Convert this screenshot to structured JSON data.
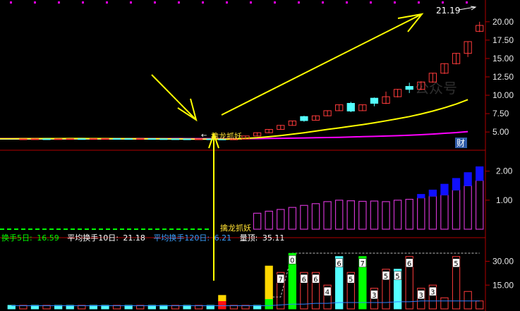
{
  "price_axis": {
    "ticks": [
      20.0,
      17.5,
      15.0,
      12.5,
      10.0,
      7.5,
      5.0
    ],
    "min": 3.0,
    "max": 22.0
  },
  "turnover_axis": {
    "ticks": [
      2.0,
      1.0
    ],
    "min": 0.0,
    "max": 2.6
  },
  "volume_axis": {
    "ticks": [
      30.0,
      15.0
    ],
    "min": 0.0,
    "max": 40.0
  },
  "price_high_label": "21.19",
  "badge_cai": "财",
  "watermark": "公众号",
  "signal_label_top": "擒龙抓妖",
  "signal_label_mid": "擒龙抓妖",
  "stats_bar": {
    "turnover5_label": "换手5日:",
    "turnover5_value": "16.59",
    "turnover10_label": "平均换手10日:",
    "turnover10_value": "21.18",
    "turnover120_label": "平均换手120日:",
    "turnover120_value": "6.21",
    "liangdu_label": "量顶:",
    "liangdu_value": "35.11"
  },
  "colors": {
    "up": "#ff3b3b",
    "down": "#54ffff",
    "ma_yellow": "#ffff00",
    "ma_magenta": "#ff00ff",
    "hist_purple": "#cc33cc",
    "hist_blue": "#1010ff",
    "vol_green": "#00ff00",
    "vol_yellow": "#ffd700",
    "stats_green": "#00ff00",
    "stats_blue": "#3aa0ff",
    "stats_white": "#ffffff"
  },
  "chart_data": {
    "type": "candlestick",
    "price_candles": [
      {
        "o": 4.02,
        "c": 4.05,
        "h": 4.1,
        "l": 4.0
      },
      {
        "o": 4.05,
        "c": 4.06,
        "h": 4.12,
        "l": 4.02
      },
      {
        "o": 4.06,
        "c": 4.05,
        "h": 4.1,
        "l": 4.0
      },
      {
        "o": 4.05,
        "c": 4.07,
        "h": 4.12,
        "l": 4.03
      },
      {
        "o": 4.07,
        "c": 4.08,
        "h": 4.12,
        "l": 4.05
      },
      {
        "o": 4.08,
        "c": 4.07,
        "h": 4.12,
        "l": 4.04
      },
      {
        "o": 4.07,
        "c": 4.09,
        "h": 4.14,
        "l": 4.05
      },
      {
        "o": 4.09,
        "c": 4.1,
        "h": 4.15,
        "l": 4.06
      },
      {
        "o": 4.1,
        "c": 4.09,
        "h": 4.14,
        "l": 4.05
      },
      {
        "o": 4.09,
        "c": 4.08,
        "h": 4.12,
        "l": 4.04
      },
      {
        "o": 4.08,
        "c": 4.09,
        "h": 4.13,
        "l": 4.05
      },
      {
        "o": 4.09,
        "c": 4.07,
        "h": 4.12,
        "l": 4.04
      },
      {
        "o": 4.07,
        "c": 4.06,
        "h": 4.1,
        "l": 4.02
      },
      {
        "o": 4.06,
        "c": 4.05,
        "h": 4.1,
        "l": 4.01
      },
      {
        "o": 4.05,
        "c": 4.04,
        "h": 4.08,
        "l": 4.0
      },
      {
        "o": 4.04,
        "c": 4.05,
        "h": 4.08,
        "l": 4.0
      },
      {
        "o": 4.05,
        "c": 4.03,
        "h": 4.08,
        "l": 3.98
      },
      {
        "o": 4.03,
        "c": 4.02,
        "h": 4.06,
        "l": 3.96
      },
      {
        "o": 4.02,
        "c": 4.04,
        "h": 4.08,
        "l": 3.98
      },
      {
        "o": 4.04,
        "c": 4.46,
        "h": 4.5,
        "l": 4.0
      },
      {
        "o": 4.46,
        "c": 4.9,
        "h": 4.95,
        "l": 4.4
      },
      {
        "o": 4.9,
        "c": 5.35,
        "h": 5.4,
        "l": 4.85
      },
      {
        "o": 5.35,
        "c": 5.9,
        "h": 5.95,
        "l": 5.3
      },
      {
        "o": 5.9,
        "c": 6.5,
        "h": 6.55,
        "l": 5.85
      },
      {
        "o": 7.1,
        "c": 6.55,
        "h": 7.2,
        "l": 6.4
      },
      {
        "o": 6.6,
        "c": 7.2,
        "h": 7.25,
        "l": 6.55
      },
      {
        "o": 7.2,
        "c": 7.9,
        "h": 7.95,
        "l": 7.15
      },
      {
        "o": 7.9,
        "c": 8.7,
        "h": 8.75,
        "l": 7.85
      },
      {
        "o": 8.9,
        "c": 7.85,
        "h": 9.1,
        "l": 7.7
      },
      {
        "o": 7.9,
        "c": 8.7,
        "h": 8.75,
        "l": 7.85
      },
      {
        "o": 9.6,
        "c": 8.9,
        "h": 9.7,
        "l": 8.5
      },
      {
        "o": 8.9,
        "c": 9.8,
        "h": 10.5,
        "l": 8.8
      },
      {
        "o": 9.8,
        "c": 10.8,
        "h": 10.85,
        "l": 9.7
      },
      {
        "o": 11.2,
        "c": 10.8,
        "h": 11.7,
        "l": 10.3
      },
      {
        "o": 10.8,
        "c": 11.8,
        "h": 11.9,
        "l": 10.7
      },
      {
        "o": 11.8,
        "c": 13.0,
        "h": 13.05,
        "l": 11.7
      },
      {
        "o": 13.0,
        "c": 14.3,
        "h": 14.35,
        "l": 12.9
      },
      {
        "o": 14.3,
        "c": 15.7,
        "h": 15.75,
        "l": 14.2
      },
      {
        "o": 15.7,
        "c": 17.3,
        "h": 17.35,
        "l": 15.2
      },
      {
        "o": 18.7,
        "c": 19.5,
        "h": 20.0,
        "l": 18.6
      }
    ],
    "ma_yellow": [
      4.08,
      4.09,
      4.09,
      4.1,
      4.1,
      4.11,
      4.11,
      4.1,
      4.1,
      4.09,
      4.09,
      4.08,
      4.08,
      4.07,
      4.06,
      4.05,
      4.04,
      4.03,
      4.02,
      4.05,
      4.12,
      4.22,
      4.35,
      4.52,
      4.7,
      4.9,
      5.12,
      5.35,
      5.55,
      5.78,
      6.0,
      6.25,
      6.52,
      6.8,
      7.1,
      7.45,
      7.85,
      8.3,
      8.8,
      9.4
    ],
    "ma_magenta": [
      4.1,
      4.1,
      4.1,
      4.1,
      4.1,
      4.1,
      4.1,
      4.1,
      4.1,
      4.1,
      4.1,
      4.1,
      4.1,
      4.1,
      4.1,
      4.09,
      4.09,
      4.09,
      4.08,
      4.08,
      4.09,
      4.1,
      4.12,
      4.14,
      4.16,
      4.19,
      4.22,
      4.25,
      4.28,
      4.32,
      4.36,
      4.4,
      4.45,
      4.5,
      4.56,
      4.63,
      4.72,
      4.82,
      4.92,
      5.05
    ],
    "turnover_hist": [
      0.02,
      0.02,
      0.02,
      0.02,
      0.02,
      0.02,
      0.02,
      0.02,
      0.02,
      0.02,
      0.02,
      0.02,
      0.02,
      0.02,
      0.02,
      0.02,
      0.02,
      0.02,
      0.02,
      0.05,
      0.55,
      0.62,
      0.68,
      0.75,
      0.82,
      0.88,
      0.95,
      1.0,
      0.98,
      0.96,
      0.97,
      0.95,
      1.0,
      1.03,
      1.08,
      1.14,
      1.18,
      1.35,
      1.5,
      1.68
    ],
    "turnover_blue": [
      0,
      0,
      0,
      0,
      0,
      0,
      0,
      0,
      0,
      0,
      0,
      0,
      0,
      0,
      0,
      0,
      0,
      0,
      0,
      0,
      0,
      0,
      0,
      0,
      0,
      0,
      0,
      0,
      0,
      0,
      0,
      0,
      0,
      1.03,
      1.2,
      1.35,
      1.55,
      1.75,
      1.95,
      2.15
    ],
    "volume_bars": [
      {
        "v": 1.5,
        "kind": "down"
      },
      {
        "v": 1.5,
        "kind": "up"
      },
      {
        "v": 1.5,
        "kind": "down"
      },
      {
        "v": 1.5,
        "kind": "up"
      },
      {
        "v": 1.5,
        "kind": "down"
      },
      {
        "v": 1.5,
        "kind": "down"
      },
      {
        "v": 1.5,
        "kind": "up"
      },
      {
        "v": 1.5,
        "kind": "down"
      },
      {
        "v": 1.5,
        "kind": "down"
      },
      {
        "v": 1.5,
        "kind": "up"
      },
      {
        "v": 1.5,
        "kind": "down"
      },
      {
        "v": 1.5,
        "kind": "up"
      },
      {
        "v": 1.5,
        "kind": "down"
      },
      {
        "v": 1.5,
        "kind": "down"
      },
      {
        "v": 1.5,
        "kind": "up"
      },
      {
        "v": 1.5,
        "kind": "down"
      },
      {
        "v": 1.5,
        "kind": "up"
      },
      {
        "v": 1.5,
        "kind": "down"
      },
      {
        "v": 8.5,
        "kind": "signal_small"
      },
      {
        "v": 1.5,
        "kind": "up"
      },
      {
        "v": 1.5,
        "kind": "up"
      },
      {
        "v": 1.5,
        "kind": "down"
      },
      {
        "v": 27.0,
        "kind": "yellow"
      },
      {
        "v": 23.0,
        "kind": "up",
        "label": "7"
      },
      {
        "v": 35.0,
        "kind": "green",
        "label": "0"
      },
      {
        "v": 23.0,
        "kind": "up",
        "label": "6"
      },
      {
        "v": 23.0,
        "kind": "up",
        "label": "6"
      },
      {
        "v": 15.0,
        "kind": "up",
        "label": "4"
      },
      {
        "v": 33.0,
        "kind": "down",
        "label": "6"
      },
      {
        "v": 23.0,
        "kind": "up",
        "label": "5"
      },
      {
        "v": 33.0,
        "kind": "green",
        "label": "7"
      },
      {
        "v": 13.0,
        "kind": "up",
        "label": "3"
      },
      {
        "v": 25.0,
        "kind": "up",
        "label": "5"
      },
      {
        "v": 25.0,
        "kind": "down",
        "label": "5"
      },
      {
        "v": 33.0,
        "kind": "up",
        "label": "6"
      },
      {
        "v": 13.0,
        "kind": "up",
        "label": "3"
      },
      {
        "v": 15.0,
        "kind": "up",
        "label": "3"
      },
      {
        "v": 7.0,
        "kind": "up"
      },
      {
        "v": 33.0,
        "kind": "up",
        "label": "5"
      },
      {
        "v": 11.0,
        "kind": "up"
      },
      {
        "v": 5.0,
        "kind": "up"
      }
    ],
    "volume_ma": [
      2,
      2,
      2,
      2,
      2,
      2,
      2,
      2,
      2,
      2,
      2,
      2,
      2,
      2,
      2,
      2,
      2,
      2,
      2,
      2,
      2,
      2,
      2,
      2.5,
      3,
      3,
      3.5,
      3.5,
      4,
      4,
      4,
      4,
      4,
      4.5,
      4.5,
      5,
      5,
      5,
      5,
      5,
      5
    ],
    "volume_ref_line": [
      7.5,
      35.11
    ]
  }
}
